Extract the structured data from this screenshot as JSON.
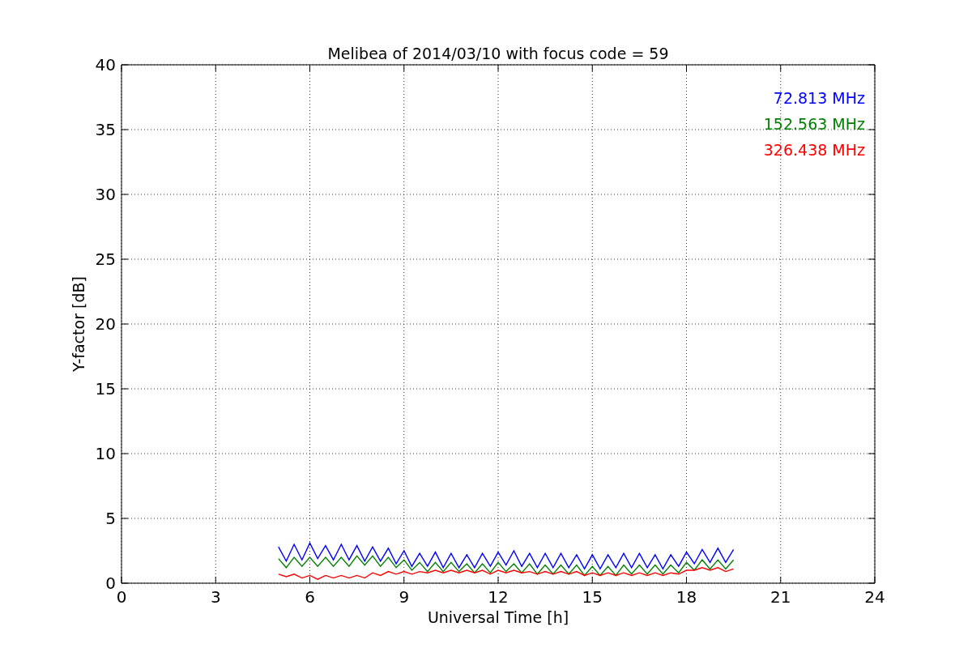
{
  "figure": {
    "chart_data": {
      "type": "line",
      "title": "Melibea of 2014/03/10 with focus code = 59",
      "xlabel": "Universal Time [h]",
      "ylabel": "Y-factor [dB]",
      "xlim": [
        0,
        24
      ],
      "ylim": [
        0,
        40
      ],
      "xticks": [
        0,
        3,
        6,
        9,
        12,
        15,
        18,
        21,
        24
      ],
      "yticks": [
        0,
        5,
        10,
        15,
        20,
        25,
        30,
        35,
        40
      ],
      "grid": true,
      "x": [
        5,
        5.25,
        5.5,
        5.75,
        6,
        6.25,
        6.5,
        6.75,
        7,
        7.25,
        7.5,
        7.75,
        8,
        8.25,
        8.5,
        8.75,
        9,
        9.25,
        9.5,
        9.75,
        10,
        10.25,
        10.5,
        10.75,
        11,
        11.25,
        11.5,
        11.75,
        12,
        12.25,
        12.5,
        12.75,
        13,
        13.25,
        13.5,
        13.75,
        14,
        14.25,
        14.5,
        14.75,
        15,
        15.25,
        15.5,
        15.75,
        16,
        16.25,
        16.5,
        16.75,
        17,
        17.25,
        17.5,
        17.75,
        18,
        18.25,
        18.5,
        18.75,
        19,
        19.25,
        19.5
      ],
      "series": [
        {
          "name": "72.813 MHz",
          "color": "#0000ff",
          "values": [
            2.8,
            1.7,
            3.0,
            1.8,
            3.1,
            1.9,
            2.9,
            1.8,
            3.0,
            1.8,
            2.9,
            1.7,
            2.8,
            1.7,
            2.7,
            1.5,
            2.5,
            1.3,
            2.3,
            1.3,
            2.4,
            1.2,
            2.3,
            1.2,
            2.2,
            1.2,
            2.3,
            1.3,
            2.4,
            1.4,
            2.5,
            1.3,
            2.3,
            1.2,
            2.3,
            1.2,
            2.3,
            1.2,
            2.2,
            1.1,
            2.2,
            1.1,
            2.2,
            1.2,
            2.3,
            1.2,
            2.3,
            1.2,
            2.2,
            1.1,
            2.2,
            1.3,
            2.4,
            1.5,
            2.6,
            1.6,
            2.7,
            1.6,
            2.6
          ]
        },
        {
          "name": "152.563 MHz",
          "color": "#008000",
          "values": [
            1.9,
            1.2,
            2.0,
            1.3,
            2.0,
            1.3,
            2.0,
            1.3,
            2.0,
            1.3,
            2.1,
            1.4,
            2.1,
            1.3,
            2.0,
            1.2,
            1.8,
            1.0,
            1.6,
            0.9,
            1.6,
            0.9,
            1.6,
            0.9,
            1.5,
            0.8,
            1.5,
            0.8,
            1.6,
            0.9,
            1.5,
            0.8,
            1.5,
            0.7,
            1.4,
            0.7,
            1.4,
            0.7,
            1.4,
            0.6,
            1.3,
            0.6,
            1.3,
            0.6,
            1.4,
            0.7,
            1.4,
            0.7,
            1.4,
            0.7,
            1.4,
            0.8,
            1.6,
            1.0,
            1.8,
            1.1,
            1.8,
            1.1,
            1.8
          ]
        },
        {
          "name": "326.438 MHz",
          "color": "#ff0000",
          "values": [
            0.7,
            0.5,
            0.7,
            0.4,
            0.6,
            0.3,
            0.6,
            0.4,
            0.6,
            0.4,
            0.6,
            0.4,
            0.8,
            0.6,
            0.9,
            0.7,
            0.9,
            0.7,
            0.9,
            0.8,
            1.0,
            0.8,
            1.0,
            0.8,
            1.0,
            0.8,
            1.0,
            0.7,
            1.0,
            0.8,
            1.0,
            0.8,
            0.9,
            0.7,
            0.9,
            0.7,
            0.9,
            0.7,
            0.9,
            0.6,
            0.8,
            0.6,
            0.8,
            0.6,
            0.8,
            0.6,
            0.8,
            0.6,
            0.8,
            0.6,
            0.8,
            0.7,
            1.0,
            1.0,
            1.2,
            1.0,
            1.2,
            0.9,
            1.1
          ]
        }
      ]
    }
  }
}
